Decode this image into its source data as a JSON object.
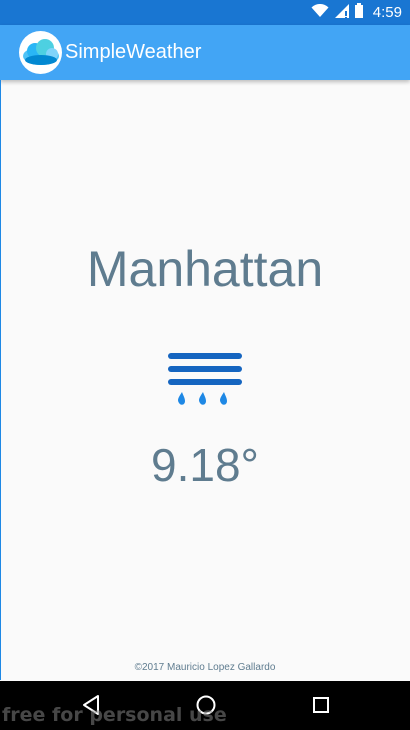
{
  "status_bar": {
    "time": "4:59",
    "icons": [
      "wifi-icon",
      "signal-icon",
      "battery-icon"
    ],
    "color": "#1976d2"
  },
  "app_bar": {
    "title": "SimpleWeather",
    "logo": "cloud-logo",
    "color": "#42a5f5"
  },
  "weather": {
    "city": "Manhattan",
    "condition_icon": "rain-icon",
    "temperature": "9.18°"
  },
  "footer": {
    "copyright": "©2017 Mauricio Lopez Gallardo"
  },
  "nav_bar": {
    "buttons": [
      "back-icon",
      "home-icon",
      "recents-icon"
    ]
  },
  "watermark": "free for personal use"
}
